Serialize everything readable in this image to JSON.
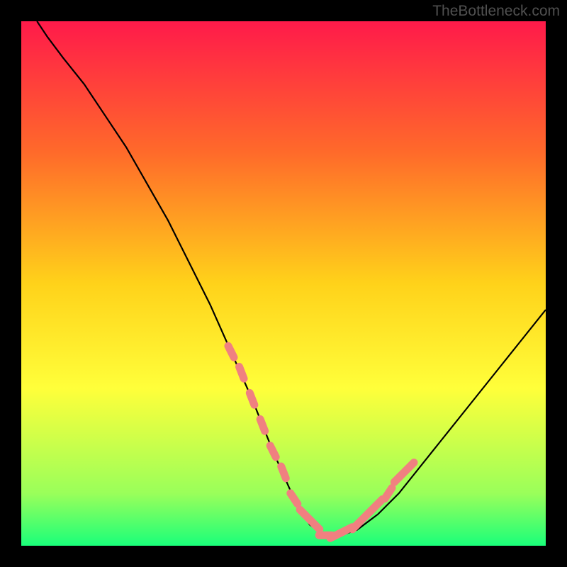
{
  "watermark": "TheBottleneck.com",
  "chart_data": {
    "type": "line",
    "title": "",
    "xlabel": "",
    "ylabel": "",
    "xlim": [
      0,
      100
    ],
    "ylim": [
      0,
      100
    ],
    "background_gradient": {
      "stops": [
        {
          "offset": 0,
          "color": "#ff1a4a"
        },
        {
          "offset": 25,
          "color": "#ff6a2a"
        },
        {
          "offset": 50,
          "color": "#ffd21a"
        },
        {
          "offset": 70,
          "color": "#ffff3a"
        },
        {
          "offset": 90,
          "color": "#9aff5a"
        },
        {
          "offset": 100,
          "color": "#1aff7a"
        }
      ]
    },
    "series": [
      {
        "name": "bottleneck-curve",
        "x": [
          3,
          5,
          8,
          12,
          16,
          20,
          24,
          28,
          32,
          36,
          40,
          44,
          48,
          52,
          55,
          58,
          61,
          64,
          68,
          72,
          76,
          80,
          84,
          88,
          92,
          96,
          100
        ],
        "y": [
          100,
          97,
          93,
          88,
          82,
          76,
          69,
          62,
          54,
          46,
          37,
          28,
          18,
          9,
          4,
          2,
          2,
          3,
          6,
          10,
          15,
          20,
          25,
          30,
          35,
          40,
          45
        ]
      }
    ],
    "segment_markers": {
      "name": "pink-dot-overlay",
      "color": "#f08080",
      "x": [
        40,
        42,
        44,
        46,
        48,
        50,
        52,
        54,
        56,
        58,
        60,
        62,
        64,
        66,
        68,
        70,
        72,
        74
      ],
      "y": [
        37,
        33,
        28,
        23,
        18,
        14,
        9,
        6,
        4,
        2,
        2,
        3,
        4,
        6,
        8,
        10,
        13,
        15
      ]
    }
  }
}
